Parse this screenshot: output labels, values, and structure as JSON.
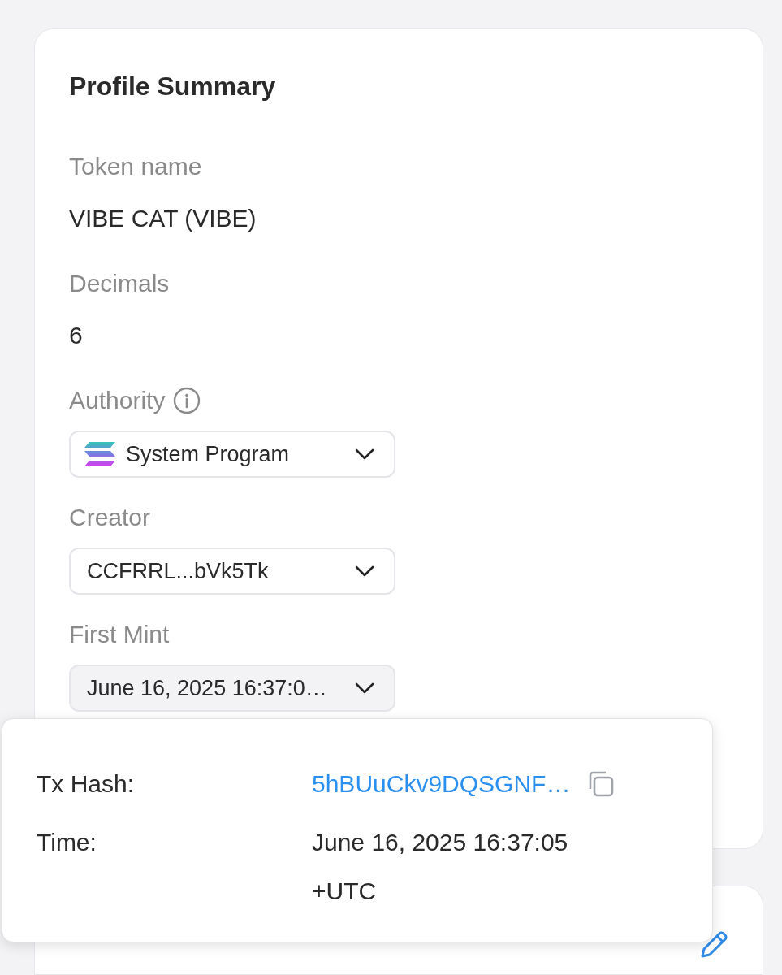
{
  "profile_summary": {
    "title": "Profile Summary",
    "fields": [
      {
        "kind": "text",
        "label": "Token name",
        "value": "VIBE CAT (VIBE)"
      },
      {
        "kind": "text",
        "label": "Decimals",
        "value": "6"
      },
      {
        "kind": "select",
        "label": "Authority",
        "info": true,
        "logo": true,
        "value": "System Program",
        "expanded": false
      },
      {
        "kind": "select",
        "label": "Creator",
        "value": "CCFRRL...bVk5Tk",
        "expanded": false
      },
      {
        "kind": "select",
        "label": "First Mint",
        "value": "June 16, 2025 16:37:0…",
        "expanded": true
      }
    ]
  },
  "popover": {
    "rows": [
      {
        "kind": "link",
        "label": "Tx Hash:",
        "value": "5hBUuCkv9DQSGNF…",
        "copy": true
      },
      {
        "kind": "text",
        "label": "Time:",
        "value": "June 16, 2025 16:37:05 +UTC"
      }
    ]
  },
  "misc": {
    "editable": true
  }
}
